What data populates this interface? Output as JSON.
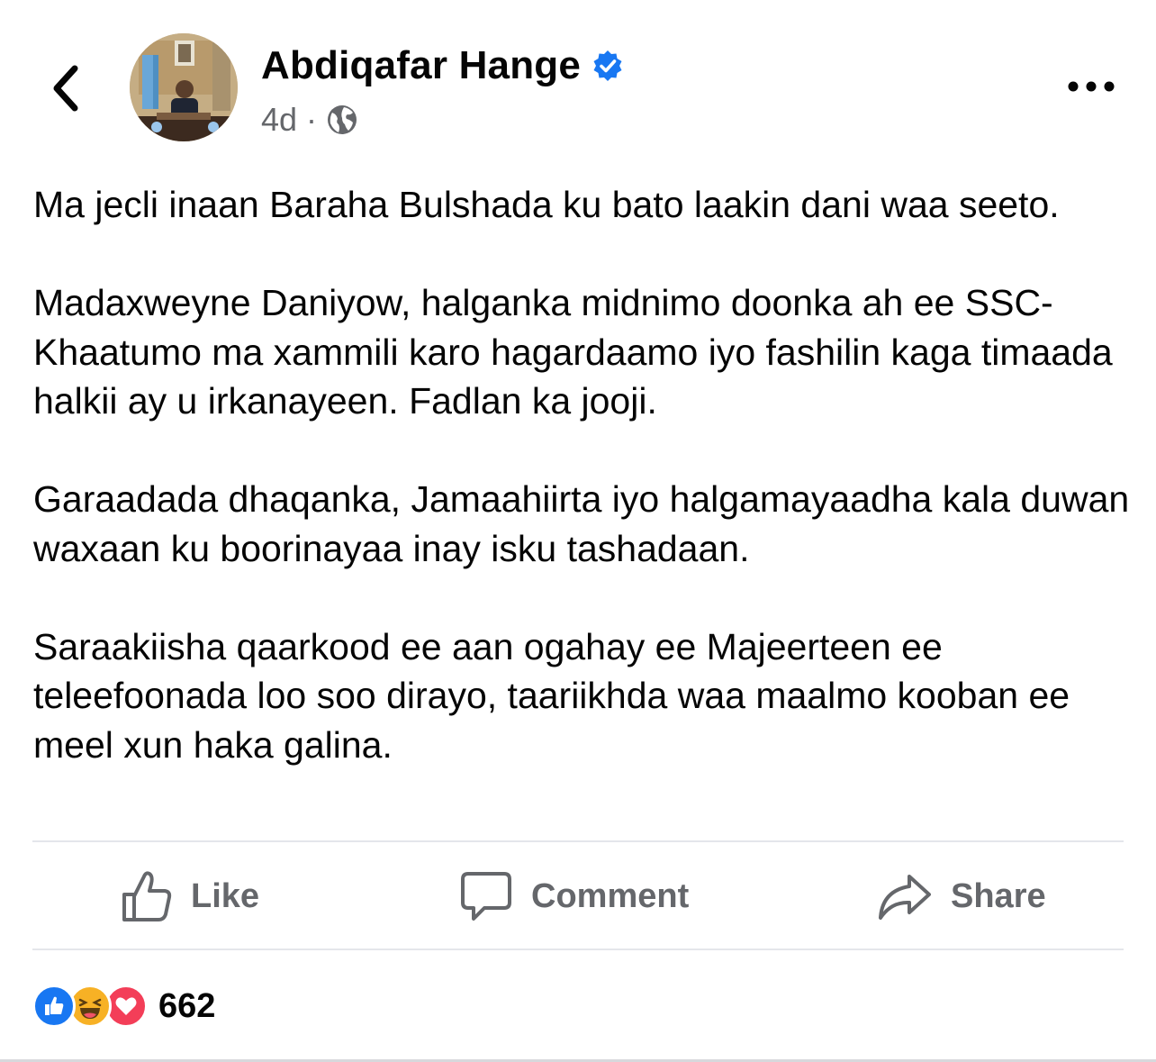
{
  "header": {
    "author_name": "Abdiqafar Hange",
    "timestamp": "4d",
    "separator": "·",
    "verified": true,
    "privacy_icon": "globe-icon"
  },
  "post": {
    "paragraphs": [
      "Ma jecli inaan Baraha Bulshada ku bato laakin dani waa seeto.",
      "Madaxweyne Daniyow, halganka midnimo doonka ah ee SSC-Khaatumo ma xammili karo hagardaamo iyo fashilin kaga timaada halkii ay u irkanayeen. Fadlan ka jooji.",
      "Garaadada dhaqanka, Jamaahiirta iyo halgamayaadha kala duwan waxaan ku boorinayaa inay isku tashadaan.",
      "Saraakiisha qaarkood ee aan ogahay ee Majeerteen ee teleefoonada loo soo dirayo, taariikhda waa maalmo kooban ee meel xun haka galina."
    ]
  },
  "actions": {
    "like_label": "Like",
    "comment_label": "Comment",
    "share_label": "Share"
  },
  "reactions": {
    "count": "662",
    "types": [
      "like-icon",
      "haha-icon",
      "love-icon"
    ]
  },
  "colors": {
    "verified_blue": "#1877f2",
    "secondary_text": "#65676b",
    "love_red": "#f33e58",
    "haha_yellow": "#f7b125"
  }
}
